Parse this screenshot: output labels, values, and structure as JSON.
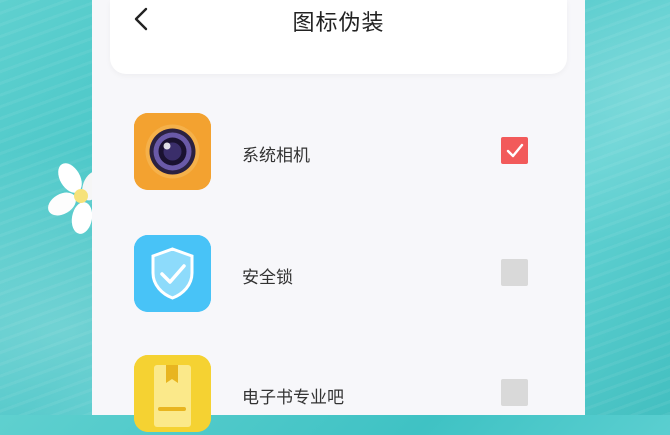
{
  "header": {
    "title": "图标伪装",
    "back_icon": "chevron-left-icon"
  },
  "apps": [
    {
      "label": "系统相机",
      "icon": "camera-icon",
      "icon_color": "#f3a230",
      "checked": true
    },
    {
      "label": "安全锁",
      "icon": "shield-check-icon",
      "icon_color": "#3cb8f4",
      "checked": false
    },
    {
      "label": "电子书专业吧",
      "icon": "book-icon",
      "icon_color": "#f5d232",
      "checked": false
    }
  ],
  "colors": {
    "accent_checked": "#f25a5a",
    "unchecked": "#d9d9d9",
    "background": "#f7f7fa"
  }
}
